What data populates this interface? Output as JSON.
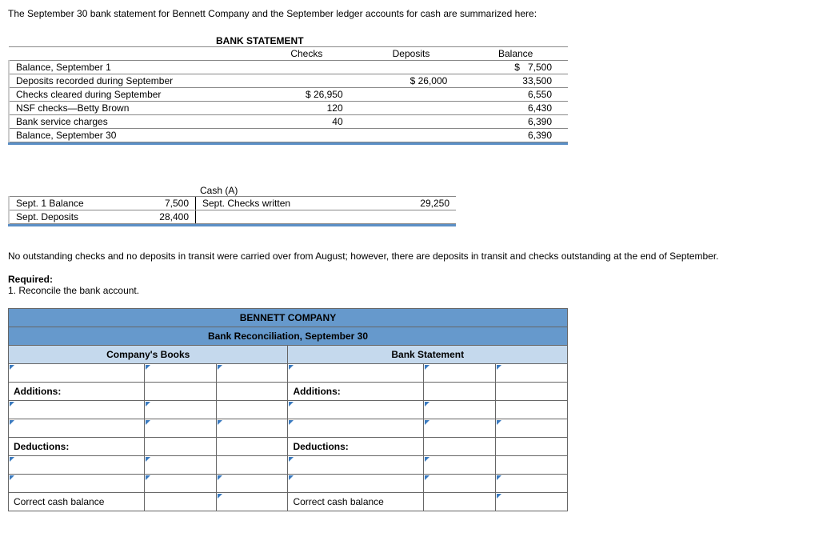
{
  "intro": "The September 30 bank statement for Bennett Company and the September ledger accounts for cash are summarized here:",
  "bank_statement": {
    "title": "BANK STATEMENT",
    "headers": {
      "checks": "Checks",
      "deposits": "Deposits",
      "balance": "Balance"
    },
    "rows": [
      {
        "label": "Balance, September 1",
        "checks": "",
        "deposits": "",
        "balance_prefix": "$",
        "balance": "7,500"
      },
      {
        "label": "Deposits recorded during September",
        "checks": "",
        "deposits": "$ 26,000",
        "balance": "33,500"
      },
      {
        "label": "Checks cleared during September",
        "checks": "$ 26,950",
        "deposits": "",
        "balance": "6,550"
      },
      {
        "label": "NSF checks—Betty Brown",
        "checks": "120",
        "deposits": "",
        "balance": "6,430"
      },
      {
        "label": "Bank service charges",
        "checks": "40",
        "deposits": "",
        "balance": "6,390"
      },
      {
        "label": "Balance, September 30",
        "checks": "",
        "deposits": "",
        "balance": "6,390"
      }
    ]
  },
  "cash_ledger": {
    "title": "Cash (A)",
    "left": [
      {
        "label": "Sept. 1 Balance",
        "amount": "7,500"
      },
      {
        "label": "Sept. Deposits",
        "amount": "28,400"
      }
    ],
    "right": [
      {
        "label": "Sept. Checks written",
        "amount": "29,250"
      }
    ]
  },
  "note": "No outstanding checks and no deposits in transit were carried over from August; however, there are deposits in transit and checks outstanding at the end of September.",
  "required_label": "Required:",
  "required_item": "1. Reconcile the bank account.",
  "reconciliation": {
    "company": "BENNETT COMPANY",
    "subtitle": "Bank Reconciliation, September 30",
    "left_header": "Company's Books",
    "right_header": "Bank Statement",
    "additions": "Additions:",
    "deductions": "Deductions:",
    "correct": "Correct cash balance"
  }
}
